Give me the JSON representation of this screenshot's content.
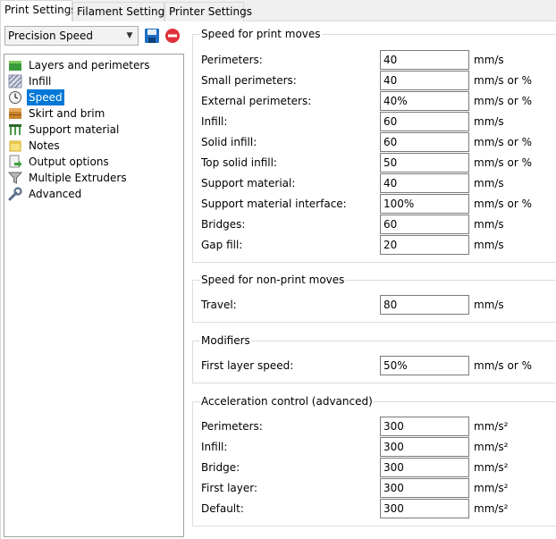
{
  "tabs": [
    {
      "label": "Print Settings",
      "active": true
    },
    {
      "label": "Filament Settings",
      "active": false
    },
    {
      "label": "Printer Settings",
      "active": false
    }
  ],
  "preset": {
    "selected": "Precision Speed"
  },
  "tree": {
    "items": [
      {
        "label": "Layers and perimeters",
        "icon": "layers-icon"
      },
      {
        "label": "Infill",
        "icon": "infill-icon"
      },
      {
        "label": "Speed",
        "icon": "speed-icon",
        "selected": true
      },
      {
        "label": "Skirt and brim",
        "icon": "skirt-icon"
      },
      {
        "label": "Support material",
        "icon": "support-icon"
      },
      {
        "label": "Notes",
        "icon": "notes-icon"
      },
      {
        "label": "Output options",
        "icon": "output-icon"
      },
      {
        "label": "Multiple Extruders",
        "icon": "funnel-icon"
      },
      {
        "label": "Advanced",
        "icon": "wrench-icon"
      }
    ]
  },
  "groups": {
    "print_moves": {
      "title": "Speed for print moves",
      "rows": [
        {
          "label": "Perimeters:",
          "value": "40",
          "unit": "mm/s"
        },
        {
          "label": "Small perimeters:",
          "value": "40",
          "unit": "mm/s or %"
        },
        {
          "label": "External perimeters:",
          "value": "40%",
          "unit": "mm/s or %"
        },
        {
          "label": "Infill:",
          "value": "60",
          "unit": "mm/s"
        },
        {
          "label": "Solid infill:",
          "value": "60",
          "unit": "mm/s or %"
        },
        {
          "label": "Top solid infill:",
          "value": "50",
          "unit": "mm/s or %"
        },
        {
          "label": "Support material:",
          "value": "40",
          "unit": "mm/s"
        },
        {
          "label": "Support material interface:",
          "value": "100%",
          "unit": "mm/s or %"
        },
        {
          "label": "Bridges:",
          "value": "60",
          "unit": "mm/s"
        },
        {
          "label": "Gap fill:",
          "value": "20",
          "unit": "mm/s"
        }
      ]
    },
    "non_print_moves": {
      "title": "Speed for non-print moves",
      "rows": [
        {
          "label": "Travel:",
          "value": "80",
          "unit": "mm/s"
        }
      ]
    },
    "modifiers": {
      "title": "Modifiers",
      "rows": [
        {
          "label": "First layer speed:",
          "value": "50%",
          "unit": "mm/s or %"
        }
      ]
    },
    "acceleration": {
      "title": "Acceleration control (advanced)",
      "rows": [
        {
          "label": "Perimeters:",
          "value": "300",
          "unit": "mm/s²"
        },
        {
          "label": "Infill:",
          "value": "300",
          "unit": "mm/s²"
        },
        {
          "label": "Bridge:",
          "value": "300",
          "unit": "mm/s²"
        },
        {
          "label": "First layer:",
          "value": "300",
          "unit": "mm/s²"
        },
        {
          "label": "Default:",
          "value": "300",
          "unit": "mm/s²"
        }
      ]
    }
  },
  "colors": {
    "selection": "#0078d7",
    "save_icon": "#1f6fc4",
    "delete_icon": "#e0303a"
  }
}
